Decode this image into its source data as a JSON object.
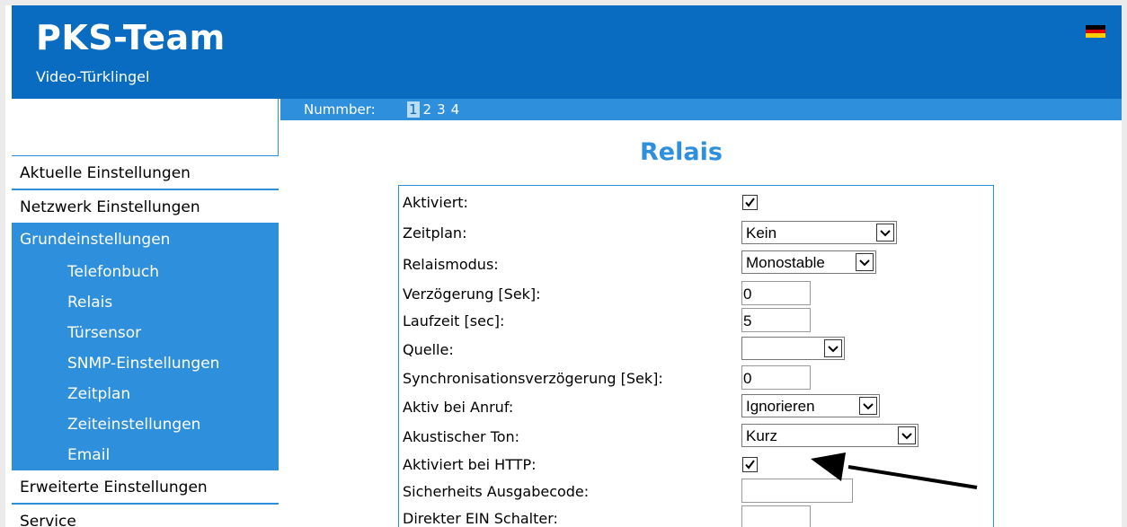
{
  "header": {
    "brand": "PKS-Team",
    "subtitle": "Video-Türklingel",
    "flag_colors": [
      "#000000",
      "#dd0000",
      "#ffce00"
    ],
    "colors": {
      "header_bg": "#0a6cc0",
      "accent": "#2e8fdc"
    }
  },
  "numbar": {
    "label": "Nummber:",
    "numbers": [
      "1",
      "2",
      "3",
      "4"
    ],
    "active": "1"
  },
  "sidebar": {
    "items": [
      {
        "label": "Aktuelle Einstellungen"
      },
      {
        "label": "Netzwerk Einstellungen"
      }
    ],
    "group": {
      "label": "Grundeinstellungen",
      "sub_items": [
        "Telefonbuch",
        "Relais",
        "Türsensor",
        "SNMP-Einstellungen",
        "Zeitplan",
        "Zeiteinstellungen",
        "Email"
      ]
    },
    "items_after": [
      {
        "label": "Erweiterte Einstellungen"
      },
      {
        "label": "Service"
      }
    ]
  },
  "main": {
    "title": "Relais",
    "rows": [
      {
        "label": "Aktiviert:",
        "type": "checkbox",
        "checked": true
      },
      {
        "label": "Zeitplan:",
        "type": "select",
        "value": "Kein"
      },
      {
        "label": "Relaismodus:",
        "type": "select",
        "value": "Monostable"
      },
      {
        "label": "Verzögerung [Sek]:",
        "type": "input",
        "value": "0"
      },
      {
        "label": "Laufzeit [sec]:",
        "type": "input",
        "value": "5"
      },
      {
        "label": "Quelle:",
        "type": "select",
        "value": ""
      },
      {
        "label": "Synchronisationsverzögerung [Sek]:",
        "type": "input",
        "value": "0"
      },
      {
        "label": "Aktiv bei Anruf:",
        "type": "select",
        "value": "Ignorieren"
      },
      {
        "label": "Akustischer Ton:",
        "type": "select",
        "value": "Kurz"
      },
      {
        "label": "Aktiviert bei HTTP:",
        "type": "checkbox",
        "checked": true
      },
      {
        "label": "Sicherheits Ausgabecode:",
        "type": "input",
        "value": ""
      },
      {
        "label": "Direkter EIN Schalter:",
        "type": "input",
        "value": ""
      }
    ]
  },
  "annotation": {
    "icon": "arrow-icon",
    "color": "#000000"
  }
}
